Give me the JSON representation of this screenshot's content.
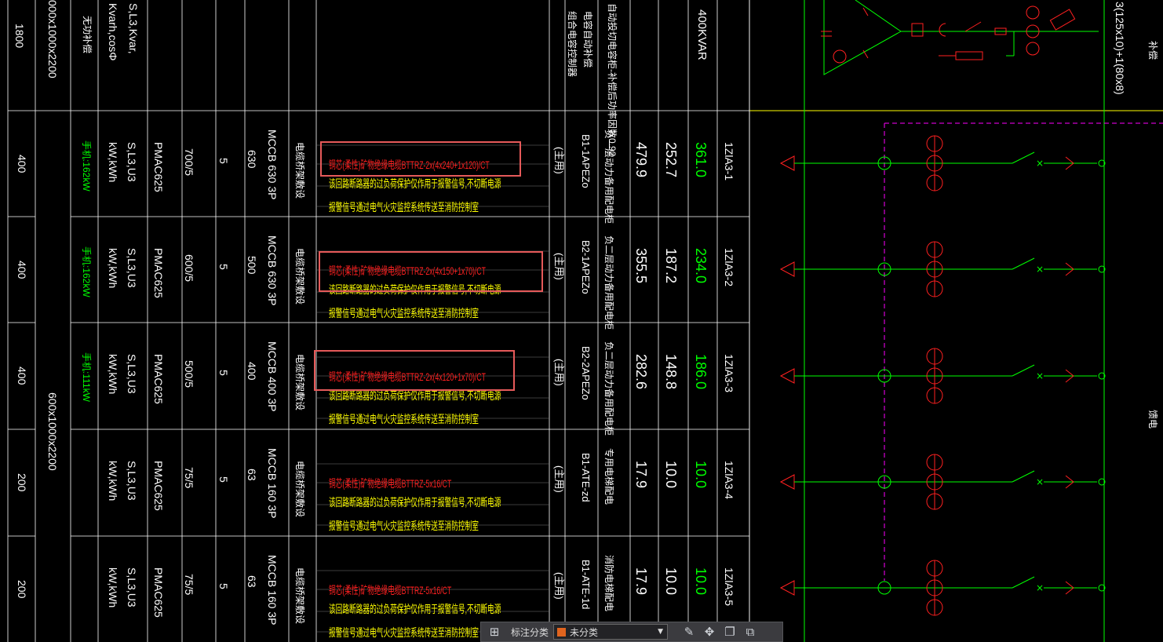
{
  "colors": {
    "grid": "#ffffff",
    "bus": "#ffff00",
    "green": "#00ff00",
    "red": "#ff2020",
    "yellow": "#ffff00",
    "magenta": "#ff00ff",
    "cyan": "#00ffff",
    "highlight": "#e65a5a"
  },
  "header": {
    "c1": "1800",
    "c2": "000x1000x2200",
    "c3": "无功补偿",
    "c4": "Kvarh,cosΦ",
    "c5": "S,L3,Kvar,",
    "c8": "电容自动补偿",
    "c8b": "组合电容控制器",
    "c9": "自动投切电容柜-补偿后功率因数0.92",
    "c11": "400KVAR",
    "c14": "3(125x10)+1(80x8)"
  },
  "section_span": "600x1000x2200",
  "right_labels": {
    "top": "补偿",
    "mid": "馈电"
  },
  "rows": [
    {
      "width": "400",
      "load": "手机:162kW",
      "meter": "S,L3,U3",
      "units": "kW,kWh",
      "pm": "PMAC625",
      "ct": "700/5",
      "n5": "5",
      "trip": "630",
      "breaker": "MCCB 630 3P",
      "cabletype": "电缆桥架敷设",
      "cable": "铜芯(柔性)矿物绝缘电缆BTTRZ-2x(4x240+1x120)/CT",
      "note1": "该回路断路器的过负荷保护仅作用于报警信号,不切断电源",
      "note2": "报警信号通过电气火灾监控系统传送至消防控制室",
      "tag": "(主用)",
      "dest": "B1-1APEZo",
      "purpose": "负一层动力备用配电柜",
      "ic": "479.9",
      "pc": "252.7",
      "pe": "361.0",
      "circuit": "1ZlA3-1"
    },
    {
      "width": "400",
      "load": "手机:162kW",
      "meter": "S,L3,U3",
      "units": "kW,kWh",
      "pm": "PMAC625",
      "ct": "600/5",
      "n5": "5",
      "trip": "500",
      "breaker": "MCCB 630 3P",
      "cabletype": "电缆桥架敷设",
      "cable": "铜芯(柔性)矿物绝缘电缆BTTRZ-2x(4x150+1x70)/CT",
      "note1": "该回路断路器的过负荷保护仅作用于报警信号,不切断电源",
      "note2": "报警信号通过电气火灾监控系统传送至消防控制室",
      "tag": "(主用)",
      "dest": "B2-1APEZo",
      "purpose": "负二层动力备用配电柜",
      "ic": "355.5",
      "pc": "187.2",
      "pe": "234.0",
      "circuit": "1ZlA3-2"
    },
    {
      "width": "400",
      "load": "手机:111kW",
      "meter": "S,L3,U3",
      "units": "kW,kWh",
      "pm": "PMAC625",
      "ct": "500/5",
      "n5": "5",
      "trip": "400",
      "breaker": "MCCB 400 3P",
      "cabletype": "电缆桥架敷设",
      "cable": "铜芯(柔性)矿物绝缘电缆BTTRZ-2x(4x120+1x70)/CT",
      "note1": "该回路断路器的过负荷保护仅作用于报警信号,不切断电源",
      "note2": "报警信号通过电气火灾监控系统传送至消防控制室",
      "tag": "(主用)",
      "dest": "B2-2APEZo",
      "purpose": "负二层动力备用配电柜",
      "ic": "282.6",
      "pc": "148.8",
      "pe": "186.0",
      "circuit": "1ZlA3-3"
    },
    {
      "width": "200",
      "load": "",
      "meter": "S,L3,U3",
      "units": "kW,kWh",
      "pm": "PMAC625",
      "ct": "75/5",
      "n5": "5",
      "trip": "63",
      "breaker": "MCCB 160 3P",
      "cabletype": "电缆桥架敷设",
      "cable": "铜芯(柔性)矿物绝缘电缆BTTRZ-5x16/CT",
      "note1": "该回路断路器的过负荷保护仅作用于报警信号,不切断电源",
      "note2": "报警信号通过电气火灾监控系统传送至消防控制室",
      "tag": "(主用)",
      "dest": "B1-ATE-zd",
      "purpose": "专用电梯配电",
      "ic": "17.9",
      "pc": "10.0",
      "pe": "10.0",
      "circuit": "1ZlA3-4"
    },
    {
      "width": "200",
      "load": "",
      "meter": "S,L3,U3",
      "units": "kW,kWh",
      "pm": "PMAC625",
      "ct": "75/5",
      "n5": "5",
      "trip": "63",
      "breaker": "MCCB 160 3P",
      "cabletype": "电缆桥架敷设",
      "cable": "铜芯(柔性)矿物绝缘电缆BTTRZ-5x16/CT",
      "note1": "该回路断路器的过负荷保护仅作用于报警信号,不切断电源",
      "note2": "报警信号通过电气火灾监控系统传送至消防控制室",
      "tag": "(主用)",
      "dest": "B1-ATE-1d",
      "purpose": "消防电梯配电",
      "ic": "17.9",
      "pc": "10.0",
      "pe": "10.0",
      "circuit": "1ZlA3-5"
    }
  ],
  "toolbar": {
    "label": "标注分类",
    "value": "未分类",
    "swatch": "#e0641e"
  }
}
